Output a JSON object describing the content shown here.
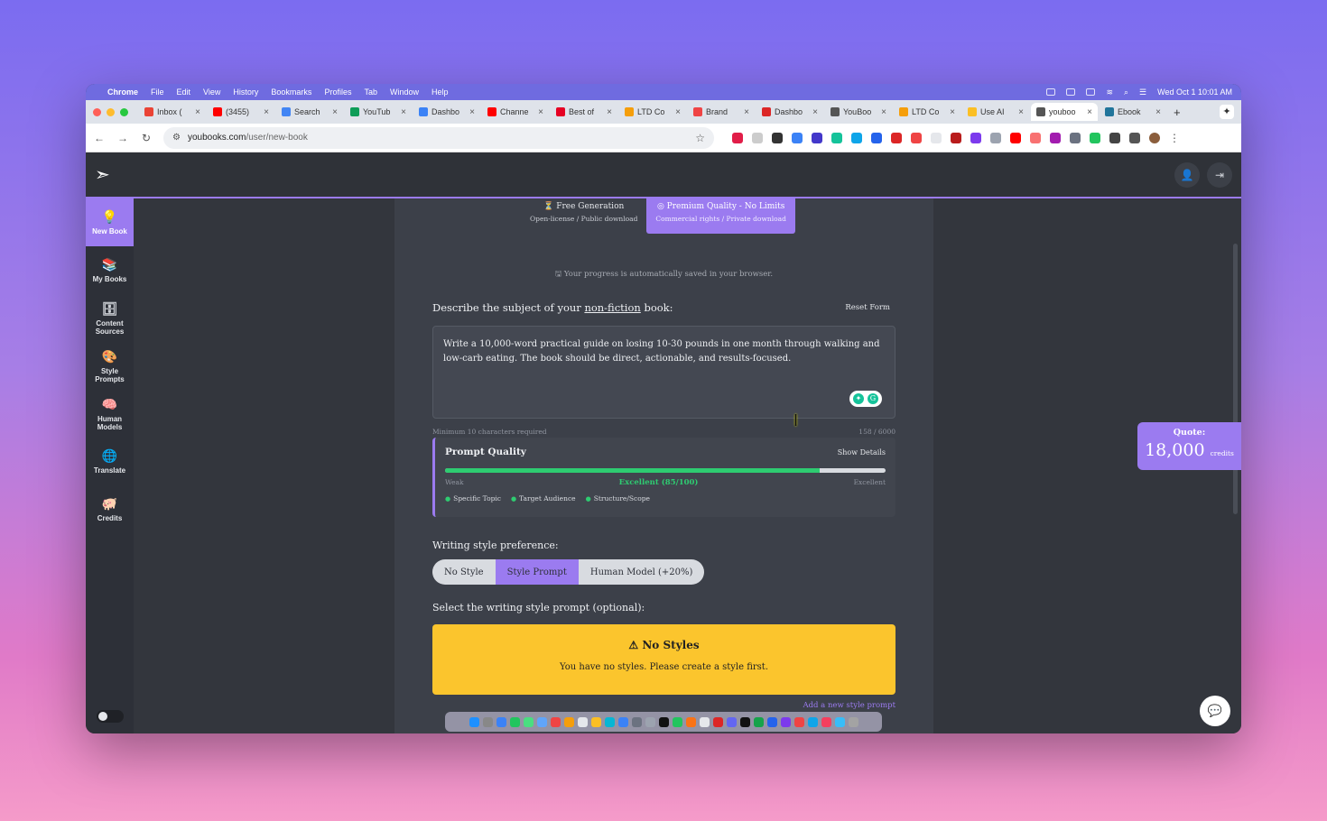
{
  "menubar": {
    "app": "Chrome",
    "items": [
      "File",
      "Edit",
      "View",
      "History",
      "Bookmarks",
      "Profiles",
      "Tab",
      "Window",
      "Help"
    ],
    "clock": "Wed Oct 1  10:01 AM"
  },
  "tabs": [
    {
      "label": "Inbox (",
      "color": "#ea4335"
    },
    {
      "label": "(3455)",
      "color": "#ff0000"
    },
    {
      "label": "Search",
      "color": "#4285f4"
    },
    {
      "label": "YouTub",
      "color": "#0f9d58"
    },
    {
      "label": "Dashbo",
      "color": "#3b82f6"
    },
    {
      "label": "Channe",
      "color": "#ff0000"
    },
    {
      "label": "Best of",
      "color": "#e60023"
    },
    {
      "label": "LTD Co",
      "color": "#f59e0b"
    },
    {
      "label": "Brand",
      "color": "#ef4444"
    },
    {
      "label": "Dashbo",
      "color": "#dc2626"
    },
    {
      "label": "YouBoo",
      "color": "#555555"
    },
    {
      "label": "LTD Co",
      "color": "#f59e0b"
    },
    {
      "label": "Use AI",
      "color": "#fbbf24"
    },
    {
      "label": "youboo",
      "color": "#555555",
      "active": true
    },
    {
      "label": "Ebook",
      "color": "#21759b"
    }
  ],
  "address": {
    "domain": "youbooks.com",
    "path": "/user/new-book"
  },
  "sidebar": {
    "items": [
      {
        "label": "New Book",
        "icon": "lightbulb-icon",
        "glyph": "💡",
        "active": true
      },
      {
        "label": "My Books",
        "icon": "books-icon",
        "glyph": "📚"
      },
      {
        "label": "Content Sources",
        "icon": "archive-icon",
        "glyph": "🗄"
      },
      {
        "label": "Style Prompts",
        "icon": "palette-icon",
        "glyph": "🎨"
      },
      {
        "label": "Human Models",
        "icon": "brain-icon",
        "glyph": "🧠"
      },
      {
        "label": "Translate",
        "icon": "globe-icon",
        "glyph": "🌐"
      },
      {
        "label": "Credits",
        "icon": "piggy-bank-icon",
        "glyph": "🐖"
      }
    ]
  },
  "quality_tabs": [
    {
      "title": "Free Generation",
      "sub": "Open-license / Public download",
      "icon": "filter-icon"
    },
    {
      "title": "Premium Quality - No Limits",
      "sub": "Commercial rights / Private download",
      "icon": "target-icon",
      "active": true
    }
  ],
  "saved_note": "Your progress is automatically saved in your browser.",
  "form": {
    "describe_prefix": "Describe the subject of your ",
    "describe_link": "non-fiction",
    "describe_suffix": " book:",
    "reset": "Reset Form",
    "textarea_value": "Write a 10,000-word practical guide on losing 10-30 pounds in one month through walking and low-carb eating. The book should be direct, actionable, and results-focused.",
    "min_chars": "Minimum 10 characters required",
    "char_count": "158 / 6000"
  },
  "prompt_quality": {
    "title": "Prompt Quality",
    "show_details": "Show Details",
    "score": 85,
    "weak": "Weak",
    "rating": "Excellent (85/100)",
    "excellent": "Excellent",
    "tags": [
      "Specific Topic",
      "Target Audience",
      "Structure/Scope"
    ]
  },
  "writing_style": {
    "label": "Writing style preference:",
    "options": [
      "No Style",
      "Style Prompt",
      "Human Model (+20%)"
    ],
    "selected": "Style Prompt"
  },
  "style_select": {
    "label": "Select the writing style prompt (optional):",
    "alert_title": "No Styles",
    "alert_body": "You have no styles. Please create a style first.",
    "add_link": "Add a new style prompt"
  },
  "quote": {
    "label": "Quote:",
    "value": "18,000",
    "unit": "credits"
  },
  "colors": {
    "accent": "#9b7bf0",
    "success": "#2ecc71",
    "warning": "#fbc52d"
  }
}
